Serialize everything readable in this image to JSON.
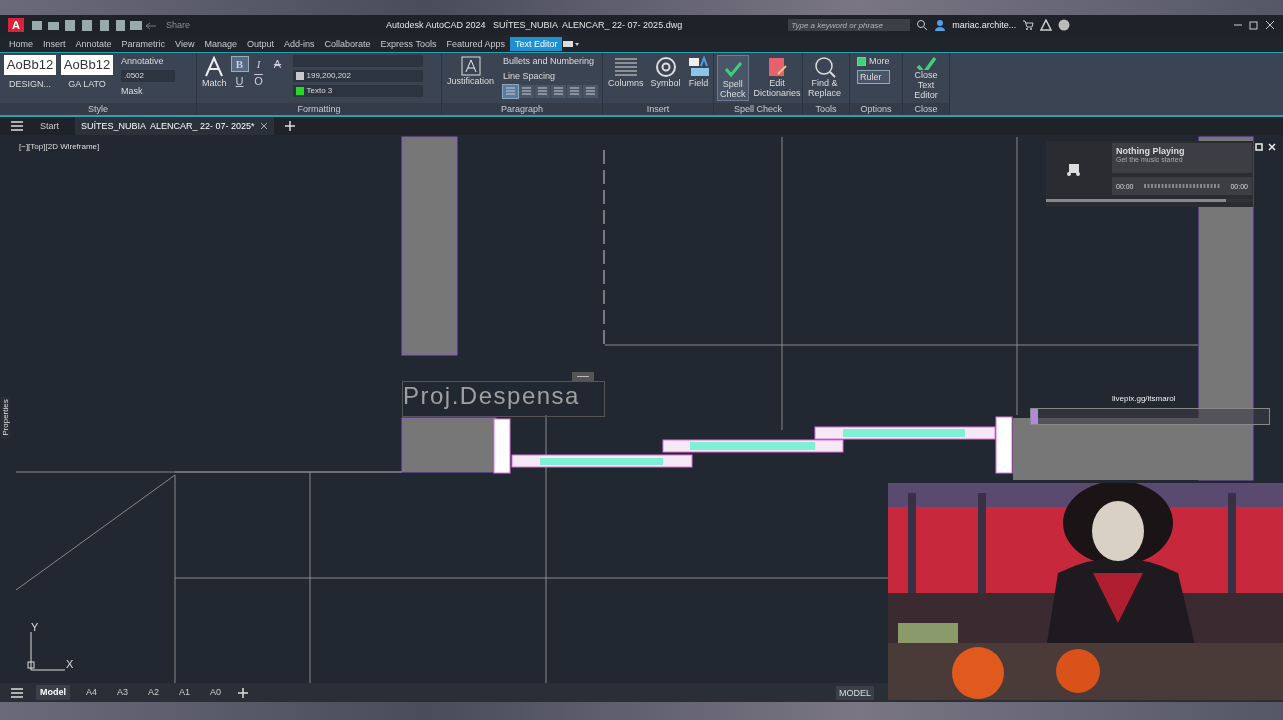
{
  "title_bar": {
    "logo": "A",
    "share": "Share",
    "title": "Autodesk AutoCAD 2024   SUÍTES_NUBIA  ALENCAR_ 22- 07- 2025.dwg",
    "search": {
      "placeholder": "Type a keyword or phrase"
    },
    "user": "mariac.archite..."
  },
  "ribbon_tabs": [
    {
      "label": "Home",
      "selected": false
    },
    {
      "label": "Insert",
      "selected": false
    },
    {
      "label": "Annotate",
      "selected": false
    },
    {
      "label": "Parametric",
      "selected": false
    },
    {
      "label": "View",
      "selected": false
    },
    {
      "label": "Manage",
      "selected": false
    },
    {
      "label": "Output",
      "selected": false
    },
    {
      "label": "Add-ins",
      "selected": false
    },
    {
      "label": "Collaborate",
      "selected": false
    },
    {
      "label": "Express Tools",
      "selected": false
    },
    {
      "label": "Featured Apps",
      "selected": false
    },
    {
      "label": "Text Editor",
      "selected": true
    }
  ],
  "style_panel": {
    "samples": [
      {
        "sample": "AoBb12",
        "name": "DESIGN..."
      },
      {
        "sample": "AoBb12",
        "name": "GA LATO"
      }
    ],
    "annotative": "Annotative",
    "height": ".0502",
    "mask": "Mask",
    "title": "Style"
  },
  "formatting_panel": {
    "match": "Match",
    "format_buttons": [
      {
        "kind": "bold",
        "label": "B",
        "selected": true
      },
      {
        "kind": "italic",
        "label": "I",
        "selected": false
      },
      {
        "kind": "strike",
        "label": "A",
        "selected": false
      },
      {
        "kind": "underline",
        "label": "U",
        "selected": false
      },
      {
        "kind": "overline",
        "label": "O",
        "selected": false
      }
    ],
    "text_color_value": "199,200,202",
    "layer": "Texto 3",
    "title": "Formatting"
  },
  "paragraph_panel": {
    "justification": "Justification",
    "bullets": "Bullets and Numbering",
    "line_spacing": "Line Spacing",
    "alignments": [
      {
        "selected": true
      },
      {
        "selected": false
      },
      {
        "selected": false
      },
      {
        "selected": false
      },
      {
        "selected": false
      },
      {
        "selected": false
      }
    ],
    "title": "Paragraph"
  },
  "insert_panel": {
    "buttons": [
      {
        "kind": "columns",
        "label": "Columns"
      },
      {
        "kind": "symbol",
        "label": "Symbol"
      },
      {
        "kind": "field",
        "label": "Field"
      }
    ],
    "title": "Insert"
  },
  "spell_panel": {
    "buttons": [
      {
        "kind": "spell",
        "label": "Spell\nCheck",
        "selected": true
      },
      {
        "kind": "dictionary",
        "label": "Edit\nDictionaries",
        "selected": false
      }
    ],
    "title": "Spell Check"
  },
  "tools_panel": {
    "find": "Find &\nReplace",
    "title": "Tools"
  },
  "options_panel": {
    "more": {
      "label": "More",
      "checked": true
    },
    "ruler": {
      "label": "Ruler",
      "selected": true
    },
    "title": "Options"
  },
  "close_panel": {
    "label": "Close\nText Editor",
    "title": "Close"
  },
  "file_tabs": [
    {
      "label": "Start",
      "selected": false
    },
    {
      "label": "SUÍTES_NUBIA  ALENCAR_ 22- 07- 2025*",
      "selected": true
    }
  ],
  "viewport": {
    "label": "[−][Top][2D Wireframe]",
    "side_palette": "Properties",
    "mtext": "Proj.Despensa",
    "ucs_x": "X",
    "ucs_y": "Y"
  },
  "layout_tabs": [
    {
      "label": "Model",
      "selected": true
    },
    {
      "label": "A4",
      "selected": false
    },
    {
      "label": "A3",
      "selected": false
    },
    {
      "label": "A2",
      "selected": false
    },
    {
      "label": "A1",
      "selected": false
    },
    {
      "label": "A0",
      "selected": false
    }
  ],
  "status_bar": {
    "space": "MODEL"
  },
  "music_widget": {
    "title": "Nothing Playing",
    "subtitle": "Get the music started",
    "elapsed": "00:00",
    "total": "00:00",
    "level": 0.87
  },
  "donation": {
    "url": "livepix.gg/itsmarol",
    "level": 0.03
  }
}
